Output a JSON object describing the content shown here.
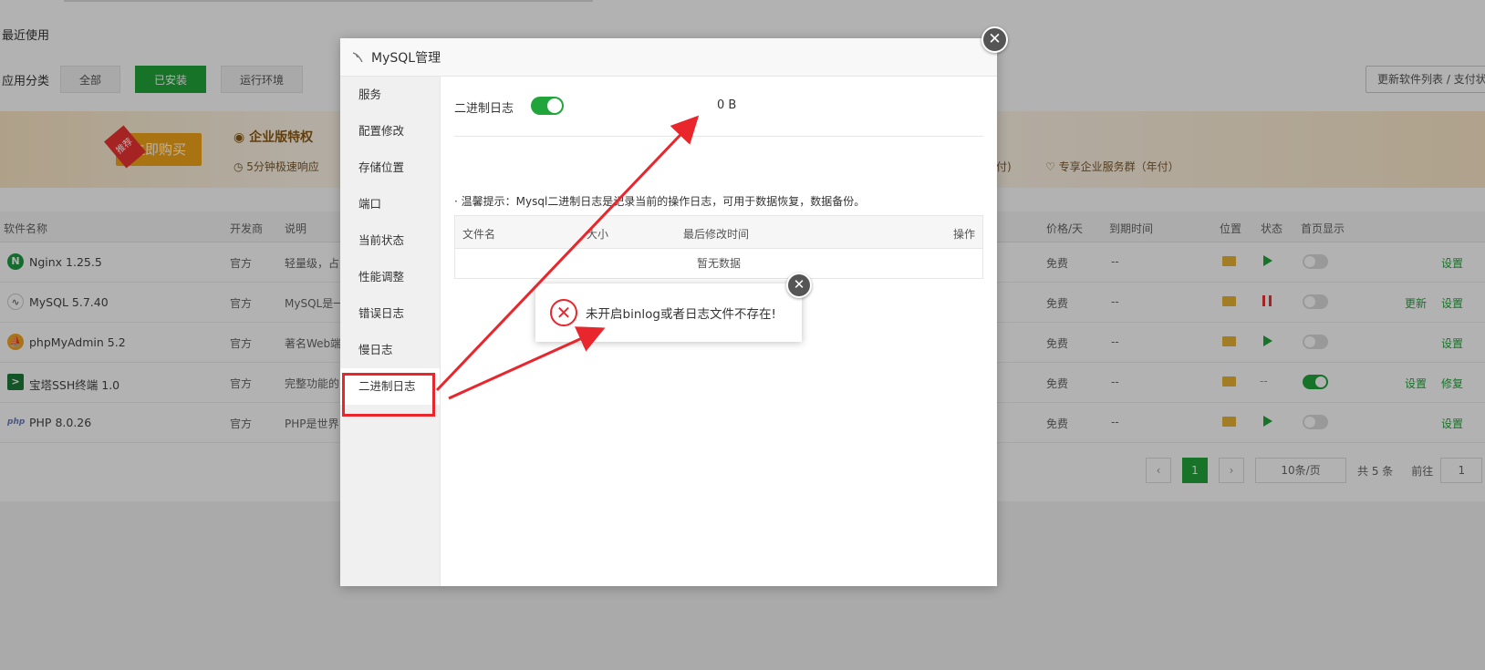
{
  "background": {
    "recent_label": "最近使用",
    "category_label": "应用分类",
    "categories": [
      "全部",
      "已安装",
      "运行环境"
    ],
    "active_category_index": 1,
    "update_button": "更新软件列表 / 支付状态",
    "banner": {
      "buy_tag": "推荐",
      "buy_button": "立即购买",
      "title": "企业版特权",
      "subtitle": "5分钟极速响应",
      "yearly_fragment": "年付)",
      "service_group": "专享企业服务群（年付）"
    },
    "table_headers": {
      "name": "软件名称",
      "developer": "开发商",
      "desc": "说明",
      "price": "价格/天",
      "expire": "到期时间",
      "location": "位置",
      "status": "状态",
      "home": "首页显示"
    },
    "rows": [
      {
        "name": "Nginx 1.25.5",
        "dev": "官方",
        "desc": "轻量级，占",
        "price": "免费",
        "expire": "--",
        "status": "play",
        "home": false,
        "actions": [
          "设置"
        ]
      },
      {
        "name": "MySQL 5.7.40",
        "dev": "官方",
        "desc": "MySQL是一",
        "price": "免费",
        "expire": "--",
        "status": "pause",
        "home": false,
        "actions": [
          "更新",
          "设置"
        ]
      },
      {
        "name": "phpMyAdmin 5.2",
        "dev": "官方",
        "desc": "著名Web端",
        "price": "免费",
        "expire": "--",
        "status": "play",
        "home": false,
        "actions": [
          "设置"
        ]
      },
      {
        "name": "宝塔SSH终端 1.0",
        "dev": "官方",
        "desc": "完整功能的",
        "price": "免费",
        "expire": "--",
        "status": "--",
        "home": true,
        "actions": [
          "设置",
          "修复"
        ]
      },
      {
        "name": "PHP 8.0.26",
        "dev": "官方",
        "desc": "PHP是世界",
        "price": "免费",
        "expire": "--",
        "status": "play",
        "home": false,
        "actions": [
          "设置"
        ]
      }
    ],
    "pager": {
      "prev": "‹",
      "current": "1",
      "next": "›",
      "page_size": "10条/页",
      "total": "共 5 条",
      "goto_label": "前往",
      "goto_value": "1"
    }
  },
  "modal": {
    "title": "MySQL管理",
    "close": "✕",
    "menu": [
      "服务",
      "配置修改",
      "存储位置",
      "端口",
      "当前状态",
      "性能调整",
      "错误日志",
      "慢日志",
      "二进制日志"
    ],
    "active_menu_index": 8,
    "binlog_label": "二进制日志",
    "binlog_enabled": true,
    "binlog_size": "0 B",
    "tip": "· 温馨提示：Mysql二进制日志是记录当前的操作日志，可用于数据恢复，数据备份。",
    "file_table": {
      "headers": [
        "文件名",
        "大小",
        "最后修改时间",
        "操作"
      ],
      "empty": "暂无数据"
    }
  },
  "message": {
    "icon": "✕",
    "text": "未开启binlog或者日志文件不存在!",
    "close": "✕"
  },
  "colors": {
    "accent": "#20a53a",
    "error": "#e8262c"
  }
}
